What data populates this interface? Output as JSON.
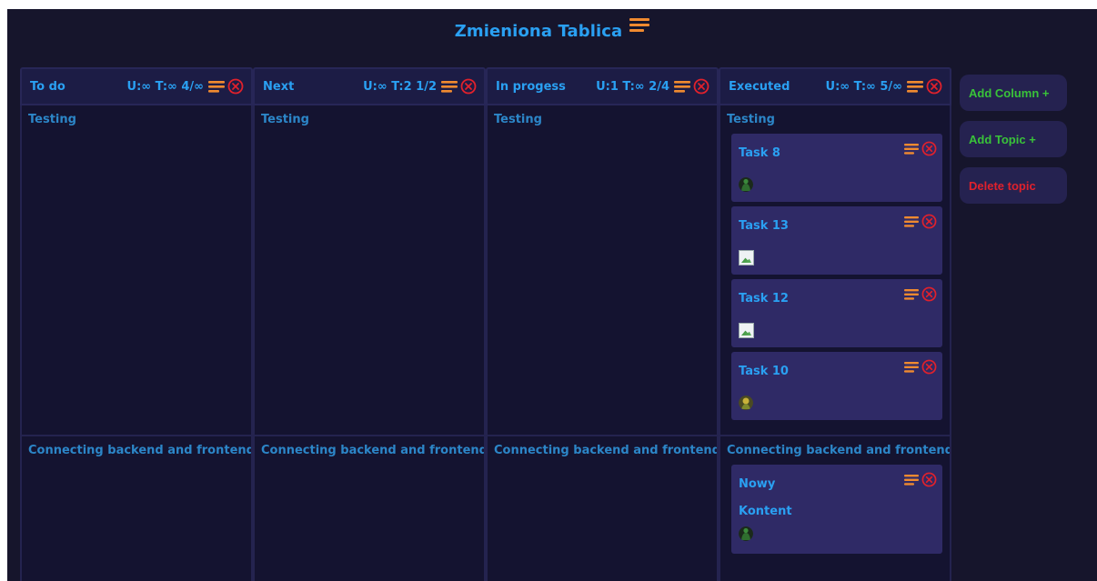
{
  "board": {
    "title": "Zmieniona Tablica"
  },
  "columns": [
    {
      "name": "To do",
      "limits": "U:∞  T:∞  4/∞"
    },
    {
      "name": "Next",
      "limits": "U:∞  T:2  1/2"
    },
    {
      "name": "In progess",
      "limits": "U:1  T:∞  2/4"
    },
    {
      "name": "Executed",
      "limits": "U:∞  T:∞  5/∞"
    }
  ],
  "topics": [
    {
      "name": "Testing"
    },
    {
      "name": "Connecting backend and frontend"
    }
  ],
  "tasks": {
    "executed_testing": [
      {
        "title": "Task 8",
        "avatar": "green-figure-avatar"
      },
      {
        "title": "Task 13",
        "avatar": "broken-image"
      },
      {
        "title": "Task 12",
        "avatar": "broken-image"
      },
      {
        "title": "Task 10",
        "avatar": "yellow-figure-avatar"
      }
    ],
    "executed_connecting": [
      {
        "title_line1": "Nowy",
        "title_line2": "Kontent",
        "avatar": "green-figure-avatar"
      }
    ]
  },
  "sidebar": {
    "add_column": "Add Column +",
    "add_topic": "Add Topic +",
    "delete_topic": "Delete topic"
  },
  "colors": {
    "background": "#16152c",
    "accent_blue": "#2aa0f2",
    "menu_orange": "#f08a30",
    "close_red": "#e0212c",
    "add_green": "#39c339",
    "task_card": "#2f2a66"
  },
  "icons": {
    "menu": "hamburger-menu-icon",
    "close": "close-circle-icon"
  }
}
